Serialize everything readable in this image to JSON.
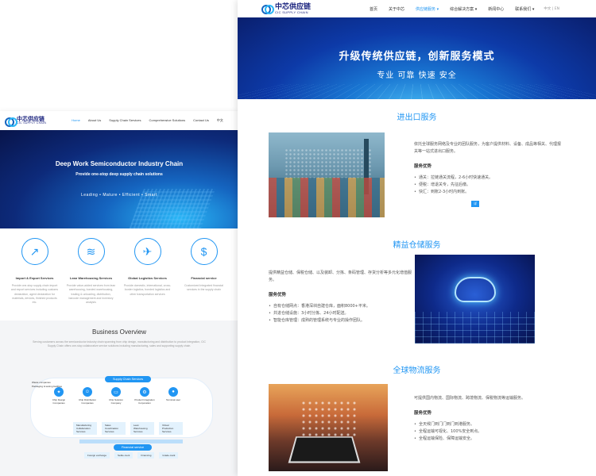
{
  "en_page": {
    "logo_cn": "中芯供应链",
    "logo_en": "CIC SUPPLY CHAIN",
    "nav": [
      "Home",
      "About Us",
      "Supply Chain Services",
      "Comprehensive Solutions",
      "Contact Us",
      "中文"
    ],
    "hero_title": "Deep Work Semiconductor Industry Chain",
    "hero_subtitle": "Provide one-stop deep supply chain solutions",
    "hero_tags": "Leading  •  Mature  •  Efficient  •  Smart",
    "services": [
      {
        "icon": "↗",
        "title": "Import & Export Services",
        "desc": "Provide one-stop supply chain import and export services including customs declaration, agent declaration for materials, devices, finished products etc."
      },
      {
        "icon": "≋",
        "title": "Lean Warehousing Services",
        "desc": "Provide value-added services from lean warehousing, bonded warehousing, trading & unloading, distribution, barcode management and inventory analysis"
      },
      {
        "icon": "✈",
        "title": "Global Logistics Services",
        "desc": "Provide domestic, international, cross-border logistics, bonded logistics and other transportation services"
      },
      {
        "icon": "$",
        "title": "Financial service",
        "desc": "Customized Integrated financial services in the supply chain"
      }
    ],
    "overview_title": "Business Overview",
    "overview_text": "Serving customers across the semiconductor industry chain spanning from chip design, manufacturing and distribution to product integration, CIC Supply Chain offers one-stop collaborative service solutions including manufacturing, sales and supporting supply chain.",
    "overview_pill": "Supply Chain Services",
    "overview_left": [
      "Waste companies",
      "Packaging & testing facilities"
    ],
    "overview_nodes": [
      "Chip Design Companies",
      "Chip Distribution Companies",
      "Chip Solution Company",
      "Product Integration Corporation",
      "Terminal user"
    ],
    "overview_boxes": [
      "Manufacturing Collaboration Services",
      "Sales Coordination Services",
      "Lean Warehousing Services",
      "Virtual Production Services"
    ],
    "finance_pill": "Financial service",
    "finance_items": [
      "Foreign exchange",
      "Settle-ment",
      "Financing",
      "Grade-mark"
    ]
  },
  "cn_page": {
    "logo_cn": "中芯供应链",
    "logo_en": "CIC SUPPLY CHAIN",
    "nav": [
      "首页",
      "关于中芯",
      "供应链服务 ▾",
      "综合解决方案 ▾",
      "新闻中心",
      "联系我们 ▾"
    ],
    "lang": "中文 | EN",
    "hero_title": "升级传统供应链，创新服务模式",
    "hero_subtitle": "专业 可靠 快速 安全",
    "sections": [
      {
        "title": "进出口服务",
        "text": "依托全球服务网络及专业的团队服务，为客户提供材料、设备、成品等相关、代理报关等一站式进出口服务。",
        "adv_title": "服务优势",
        "adv": [
          "通关：拉链通关流程，2-6小时快速通关。",
          "便税：增退关专，先征后缴。",
          "快汇：到账2-3小时内到账。"
        ],
        "button": "详"
      },
      {
        "title": "精益仓储服务",
        "text": "提供精益仓储、保税仓储、以及装卸、分拣、条码管理、存货分析等多元化增值服务。",
        "adv_title": "服务优势",
        "adv": [
          "自有仓储网点：香港深圳自建仓库，面积8000+平米。",
          "共进仓储设施：3小时分拣、24小时配送。",
          "智能仓库管理：成熟的管理系统与专业的操作团队。"
        ]
      },
      {
        "title": "全球物流服务",
        "text": "可提供国内物流、国际物流、跨境物流、保税物流等运输服务。",
        "adv_title": "服务优势",
        "adv": [
          "全天候门到门门到门到港服务。",
          "全程运输可视化、100%安全到点。",
          "全程运输保险、保障运输安全。"
        ]
      }
    ]
  },
  "colors": {
    "accent": "#2196f3",
    "brand_dark": "#1a237e",
    "hero_dark": "#0a1f6e"
  }
}
